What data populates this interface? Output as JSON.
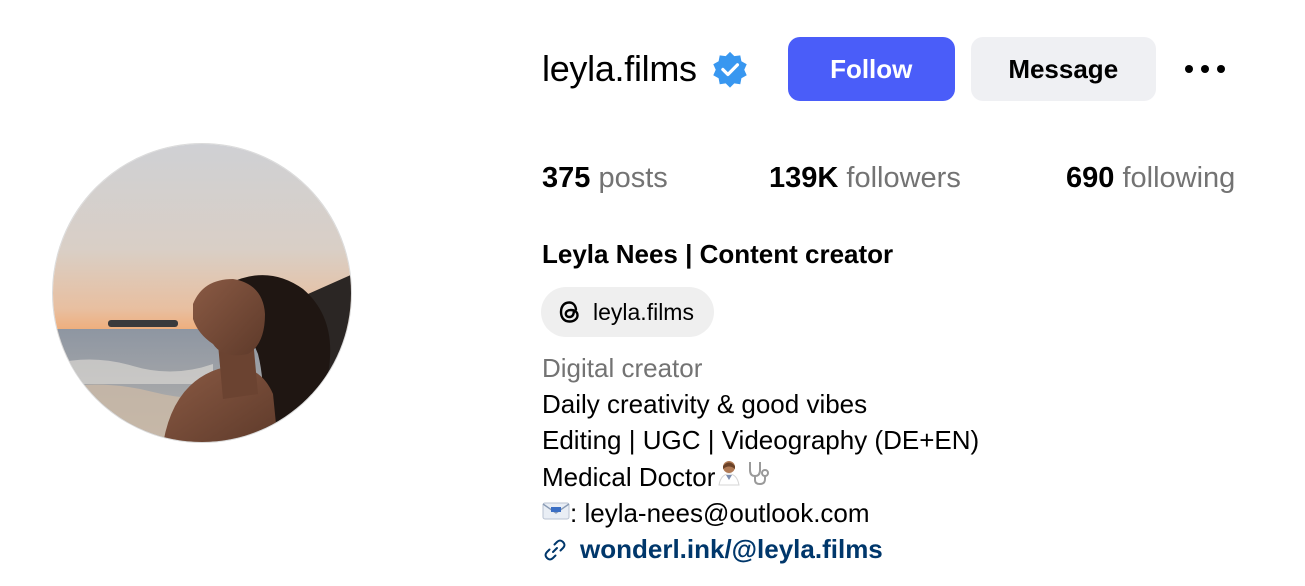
{
  "profile": {
    "username": "leyla.films",
    "verified_icon": "verified-badge-icon",
    "follow_label": "Follow",
    "message_label": "Message",
    "more_icon": "more-options-icon"
  },
  "stats": {
    "posts_count": "375",
    "posts_label": "posts",
    "followers_count": "139K",
    "followers_label": "followers",
    "following_count": "690",
    "following_label": "following"
  },
  "full_name": "Leyla Nees | Content creator",
  "threads": {
    "icon": "threads-icon",
    "handle": "leyla.films"
  },
  "bio": {
    "category": "Digital creator",
    "lines": [
      "Daily creativity & good vibes",
      "Editing | UGC | Videography (DE+EN)",
      "Medical Doctor"
    ],
    "email_prefix": ": ",
    "email": "leyla-nees@outlook.com",
    "link": "wonderl.ink/@leyla.films"
  },
  "colors": {
    "accent": "#4a5df9",
    "link": "#00376b",
    "secondary_text": "#737373",
    "verified": "#3897f0"
  }
}
